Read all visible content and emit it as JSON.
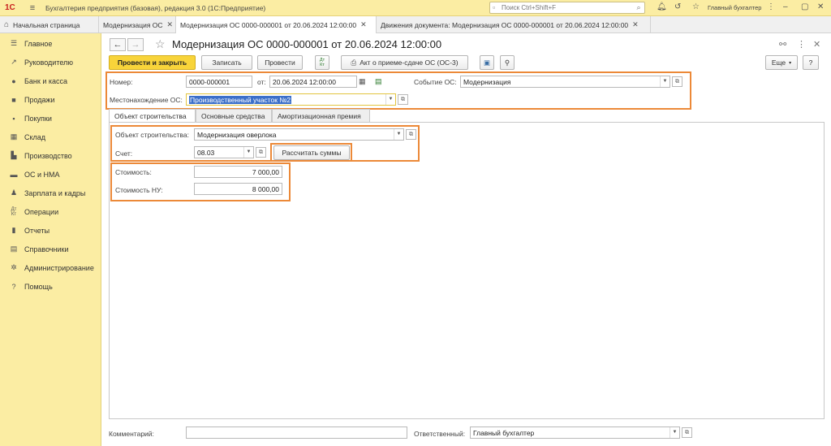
{
  "topbar": {
    "logo": "1С",
    "title": "Бухгалтерия предприятия (базовая), редакция 3.0  (1С:Предприятие)",
    "search_placeholder": "Поиск Ctrl+Shift+F",
    "user": "Главный бухгалтер",
    "icons": [
      "bell-icon",
      "history-icon",
      "star-icon",
      "user-icon",
      "more-icon",
      "minimize-icon",
      "maximize-icon",
      "close-icon"
    ]
  },
  "tabs": [
    {
      "label": "Начальная страница"
    },
    {
      "label": "Модернизация ОС"
    },
    {
      "label": "Модернизация ОС 0000-000001 от 20.06.2024 12:00:00"
    },
    {
      "label": "Движения документа: Модернизация ОС 0000-000001 от 20.06.2024 12:00:00"
    }
  ],
  "sidebar": {
    "items": [
      {
        "label": "Главное",
        "icon": "menu-icon"
      },
      {
        "label": "Руководителю",
        "icon": "chart-icon"
      },
      {
        "label": "Банк и касса",
        "icon": "bank-icon"
      },
      {
        "label": "Продажи",
        "icon": "bag-icon"
      },
      {
        "label": "Покупки",
        "icon": "cart-icon"
      },
      {
        "label": "Склад",
        "icon": "warehouse-icon"
      },
      {
        "label": "Производство",
        "icon": "factory-icon"
      },
      {
        "label": "ОС и НМА",
        "icon": "truck-icon"
      },
      {
        "label": "Зарплата и кадры",
        "icon": "people-icon"
      },
      {
        "label": "Операции",
        "icon": "operations-icon"
      },
      {
        "label": "Отчеты",
        "icon": "reports-icon"
      },
      {
        "label": "Справочники",
        "icon": "book-icon"
      },
      {
        "label": "Администрирование",
        "icon": "gear-icon"
      },
      {
        "label": "Помощь",
        "icon": "help-icon"
      }
    ]
  },
  "doc": {
    "title": "Модернизация ОС 0000-000001 от 20.06.2024 12:00:00"
  },
  "toolbar": {
    "post_close": "Провести и закрыть",
    "save": "Записать",
    "post": "Провести",
    "dt_kt": "Дт\nКт",
    "act": "Акт о приеме-сдаче ОС (ОС-3)",
    "more": "Еще",
    "help": "?"
  },
  "form": {
    "number_label": "Номер:",
    "number_value": "0000-000001",
    "date_label": "от:",
    "date_value": "20.06.2024 12:00:00",
    "event_label": "Событие ОС:",
    "event_value": "Модернизация",
    "location_label": "Местонахождение ОС:",
    "location_value": "Производственный участок №2"
  },
  "form_tabs": [
    {
      "label": "Объект строительства"
    },
    {
      "label": "Основные средства"
    },
    {
      "label": "Амортизационная премия"
    }
  ],
  "panel": {
    "object_label": "Объект строительства:",
    "object_value": "Модернизация оверлока",
    "account_label": "Счет:",
    "account_value": "08.03",
    "calc_button": "Рассчитать суммы",
    "cost_label": "Стоимость:",
    "cost_value": "7 000,00",
    "cost_nu_label": "Стоимость НУ:",
    "cost_nu_value": "8 000,00"
  },
  "footer": {
    "comment_label": "Комментарий:",
    "comment_value": "",
    "responsible_label": "Ответственный:",
    "responsible_value": "Главный бухгалтер"
  },
  "colors": {
    "sidebar_bg": "#fbeda3",
    "primary_button": "#f8d43a",
    "highlight": "#ec8938",
    "selection": "#3b6fc9"
  }
}
